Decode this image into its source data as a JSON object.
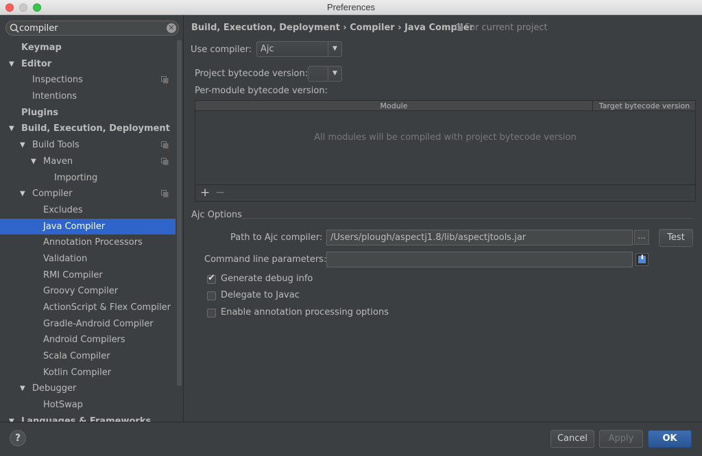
{
  "window": {
    "title": "Preferences"
  },
  "search": {
    "value": "compiler",
    "placeholder": ""
  },
  "tree": [
    {
      "label": "Keymap",
      "level": 1,
      "bold": true,
      "arrow": ""
    },
    {
      "label": "Editor",
      "level": 1,
      "bold": true,
      "arrow": "▼"
    },
    {
      "label": "Inspections",
      "level": 2,
      "copy": true,
      "arrow": ""
    },
    {
      "label": "Intentions",
      "level": 2,
      "arrow": ""
    },
    {
      "label": "Plugins",
      "level": 1,
      "bold": true,
      "arrow": ""
    },
    {
      "label": "Build, Execution, Deployment",
      "level": 1,
      "bold": true,
      "arrow": "▼"
    },
    {
      "label": "Build Tools",
      "level": 2,
      "copy": true,
      "arrow": "▼"
    },
    {
      "label": "Maven",
      "level": 3,
      "copy": true,
      "arrow": "▼"
    },
    {
      "label": "Importing",
      "level": 4,
      "arrow": ""
    },
    {
      "label": "Compiler",
      "level": 2,
      "copy": true,
      "arrow": "▼"
    },
    {
      "label": "Excludes",
      "level": 3,
      "arrow": ""
    },
    {
      "label": "Java Compiler",
      "level": 3,
      "selected": true,
      "arrow": ""
    },
    {
      "label": "Annotation Processors",
      "level": 3,
      "arrow": ""
    },
    {
      "label": "Validation",
      "level": 3,
      "arrow": ""
    },
    {
      "label": "RMI Compiler",
      "level": 3,
      "arrow": ""
    },
    {
      "label": "Groovy Compiler",
      "level": 3,
      "arrow": ""
    },
    {
      "label": "ActionScript & Flex Compiler",
      "level": 3,
      "arrow": ""
    },
    {
      "label": "Gradle-Android Compiler",
      "level": 3,
      "arrow": ""
    },
    {
      "label": "Android Compilers",
      "level": 3,
      "arrow": ""
    },
    {
      "label": "Scala Compiler",
      "level": 3,
      "arrow": ""
    },
    {
      "label": "Kotlin Compiler",
      "level": 3,
      "arrow": ""
    },
    {
      "label": "Debugger",
      "level": 2,
      "arrow": "▼"
    },
    {
      "label": "HotSwap",
      "level": 3,
      "arrow": ""
    },
    {
      "label": "Languages & Frameworks",
      "level": 1,
      "bold": true,
      "arrow": "▼"
    }
  ],
  "main": {
    "breadcrumb": "Build, Execution, Deployment › Compiler › Java Compiler",
    "scope": "For current project",
    "use_compiler_label": "Use compiler:",
    "use_compiler_value": "Ajc",
    "project_bytecode_label": "Project bytecode version:",
    "project_bytecode_value": "",
    "per_module_label": "Per-module bytecode version:",
    "table": {
      "col_module": "Module",
      "col_target": "Target bytecode version",
      "empty": "All modules will be compiled with project bytecode version",
      "add": "+",
      "remove": "−"
    },
    "ajc": {
      "section": "Ajc Options",
      "path_label": "Path to Ajc compiler:",
      "path_value": "/Users/plough/aspectj1.8/lib/aspectjtools.jar",
      "browse": "...",
      "test": "Test",
      "cmd_label": "Command line parameters:",
      "cmd_value": ""
    },
    "options": [
      {
        "label": "Generate debug info",
        "checked": true
      },
      {
        "label": "Delegate to Javac",
        "checked": false
      },
      {
        "label": "Enable annotation processing options",
        "checked": false
      }
    ]
  },
  "footer": {
    "help": "?",
    "cancel": "Cancel",
    "apply": "Apply",
    "ok": "OK"
  }
}
